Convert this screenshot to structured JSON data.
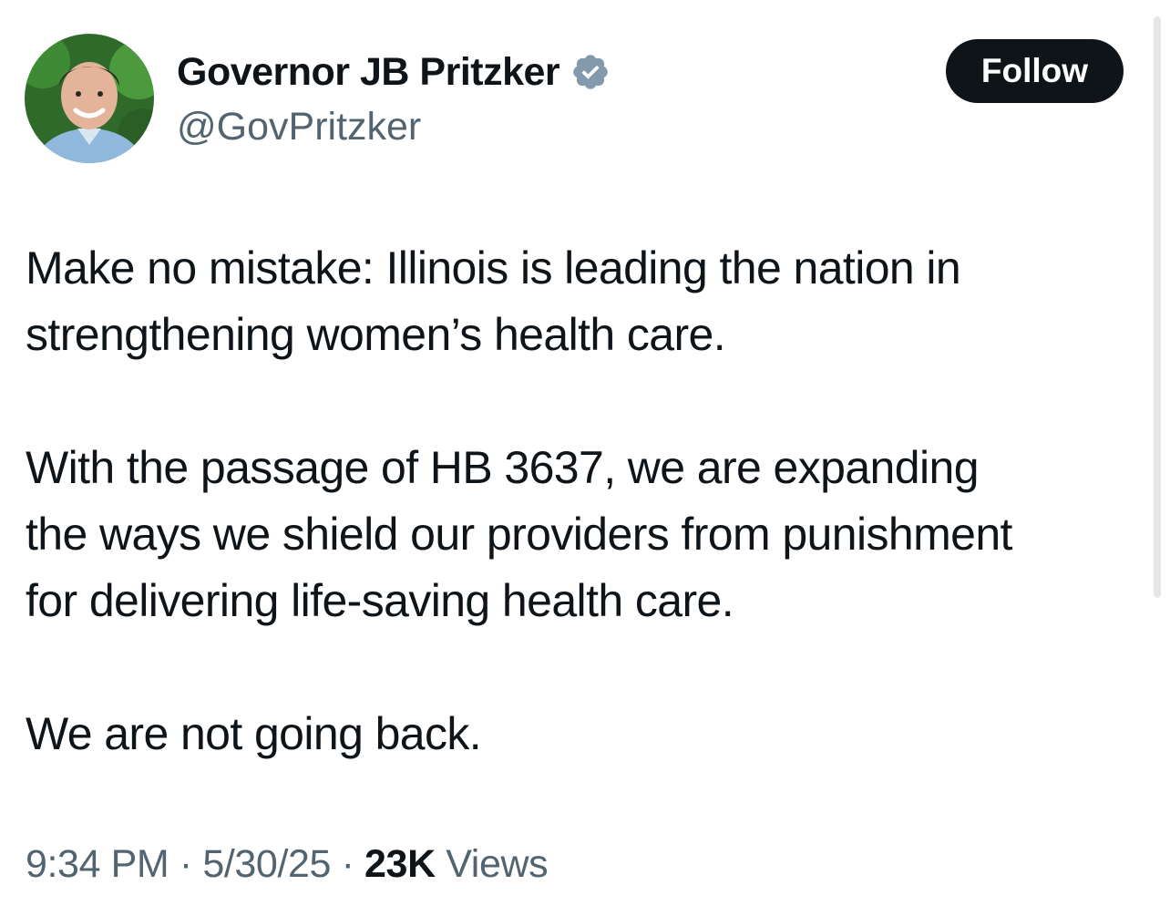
{
  "author": {
    "display_name": "Governor JB Pritzker",
    "handle": "@GovPritzker",
    "verified_icon": "verified-badge-icon",
    "verified_color": "#829aab"
  },
  "follow_button": {
    "label": "Follow",
    "background": "#0f1419",
    "text_color": "#ffffff"
  },
  "tweet": {
    "paragraphs": [
      [
        "Make no mistake: Illinois is leading the nation in",
        "strengthening women’s health care."
      ],
      [
        "With the passage of HB 3637, we are expanding",
        "the ways we shield our providers from punishment",
        "for delivering life-saving health care."
      ],
      [
        "We are not going back."
      ]
    ]
  },
  "meta": {
    "time": "9:34 PM",
    "separator": "·",
    "date": "5/30/25",
    "views_count": "23K",
    "views_label": "Views"
  }
}
